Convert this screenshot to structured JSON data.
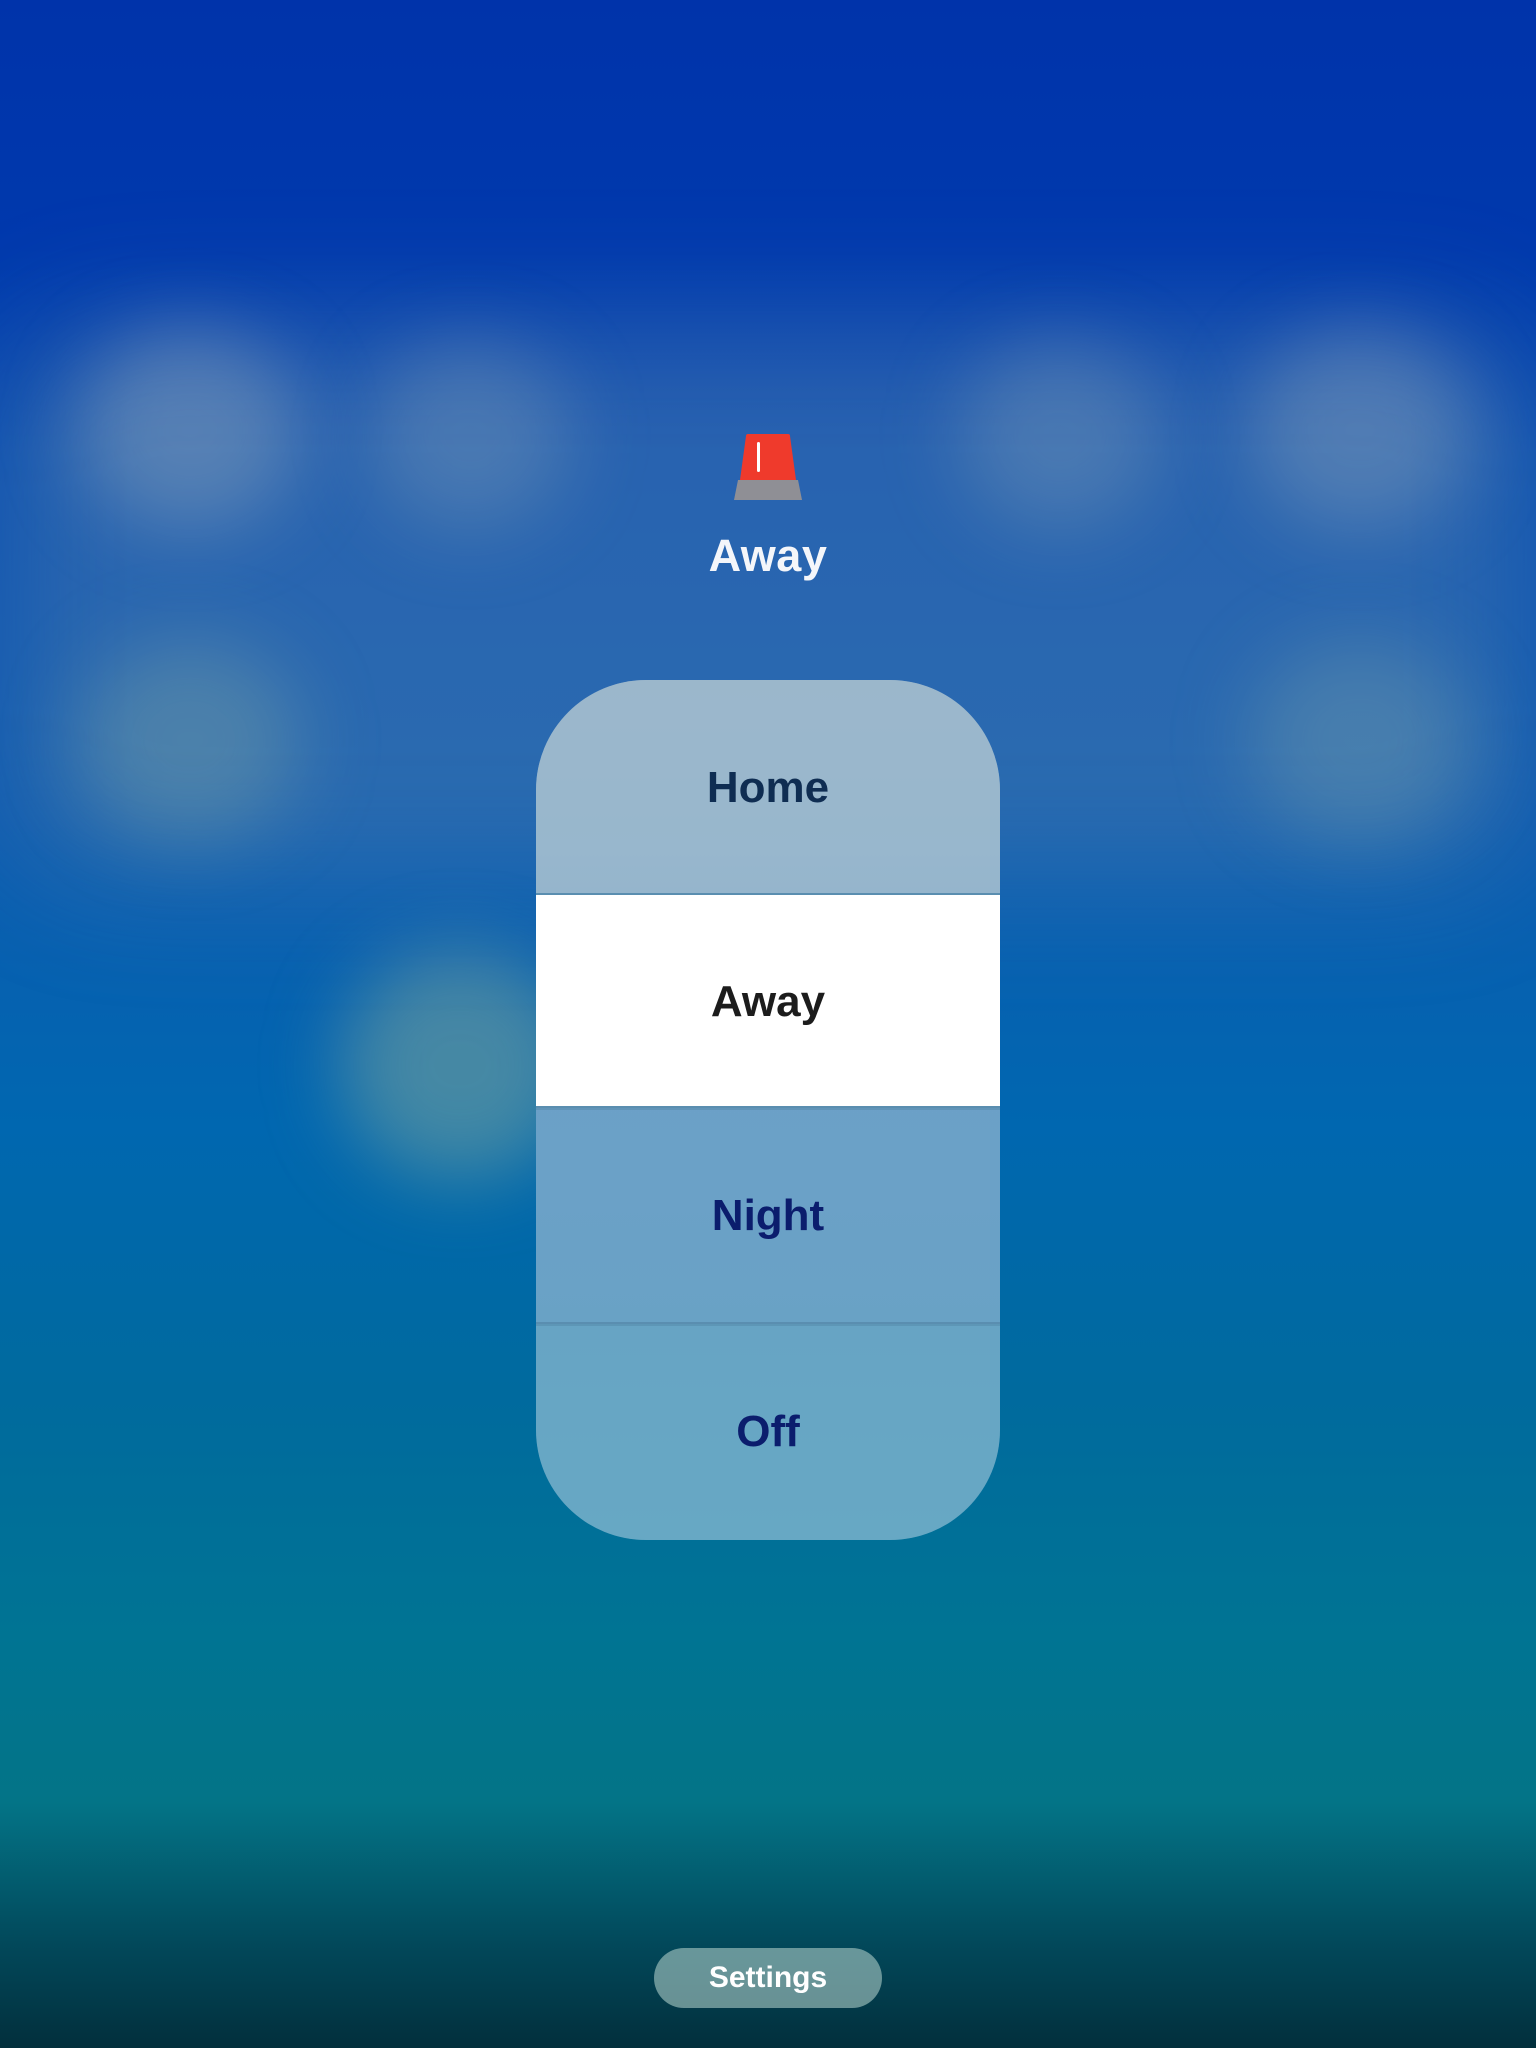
{
  "header": {
    "icon": "alarm-siren-icon",
    "title": "Away",
    "icon_colors": {
      "dome": "#ef3a2c",
      "base": "#8f8f95"
    }
  },
  "modes": {
    "selected": "Away",
    "items": [
      {
        "label": "Home"
      },
      {
        "label": "Away"
      },
      {
        "label": "Night"
      },
      {
        "label": "Off"
      }
    ]
  },
  "footer": {
    "settings_label": "Settings"
  },
  "colors": {
    "selected_background": "#ffffff",
    "selected_text": "#1c1c1c",
    "unselected_text": "#0b1d6d"
  }
}
